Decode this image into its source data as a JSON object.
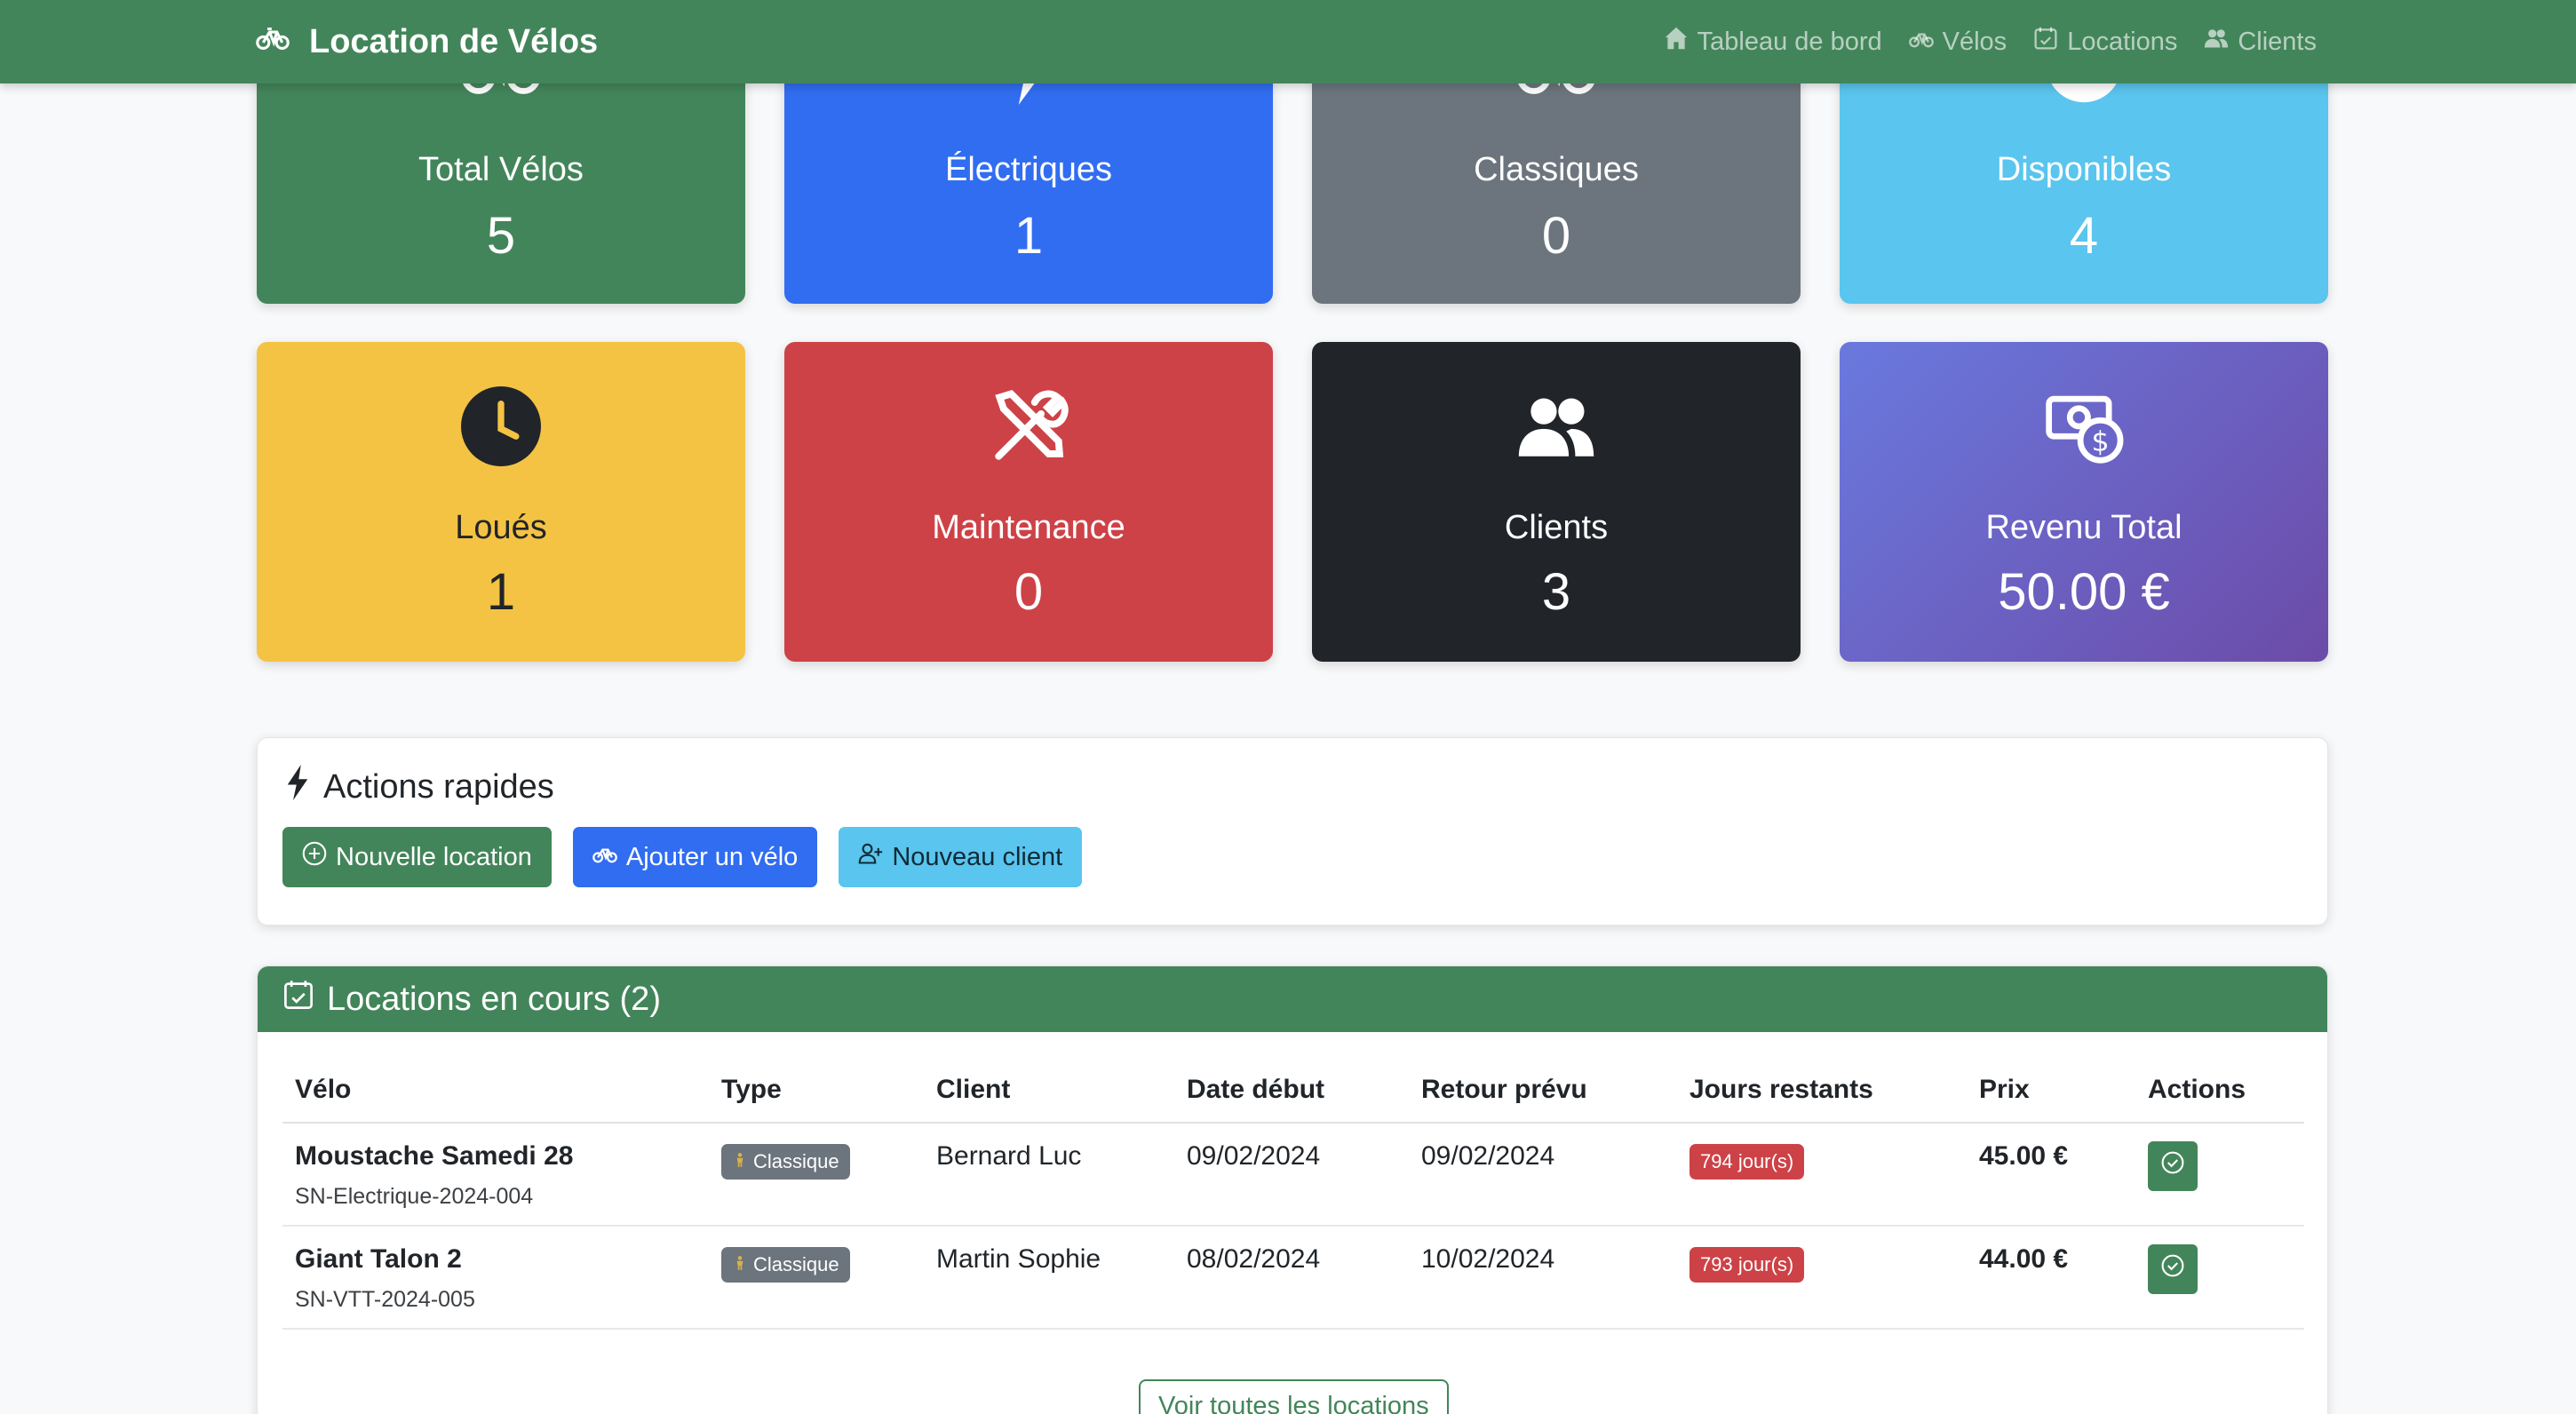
{
  "navbar": {
    "brand": "Location de Vélos",
    "links": [
      {
        "label": "Tableau de bord",
        "icon": "house-icon"
      },
      {
        "label": "Vélos",
        "icon": "bicycle-icon"
      },
      {
        "label": "Locations",
        "icon": "calendar-check-icon"
      },
      {
        "label": "Clients",
        "icon": "people-icon"
      }
    ]
  },
  "stats": [
    {
      "label": "Total Vélos",
      "value": "5",
      "icon": "bicycle-icon",
      "color": "#43855a"
    },
    {
      "label": "Électriques",
      "value": "1",
      "icon": "lightning-icon",
      "color": "#316df1"
    },
    {
      "label": "Classiques",
      "value": "0",
      "icon": "bicycle-icon",
      "color": "#6c757d"
    },
    {
      "label": "Disponibles",
      "value": "4",
      "icon": "check-circle-icon",
      "color": "#5ac5ee"
    },
    {
      "label": "Loués",
      "value": "1",
      "icon": "clock-icon",
      "color": "#f4c343"
    },
    {
      "label": "Maintenance",
      "value": "0",
      "icon": "tools-icon",
      "color": "#cd4247"
    },
    {
      "label": "Clients",
      "value": "3",
      "icon": "people-icon",
      "color": "#212429"
    },
    {
      "label": "Revenu Total",
      "value": "50.00 €",
      "icon": "cash-coin-icon",
      "color": "#6a5fc6"
    }
  ],
  "quick_actions": {
    "title": "Actions rapides",
    "buttons": [
      {
        "label": "Nouvelle location",
        "icon": "plus-circle-icon"
      },
      {
        "label": "Ajouter un vélo",
        "icon": "bicycle-icon"
      },
      {
        "label": "Nouveau client",
        "icon": "person-plus-icon"
      }
    ]
  },
  "rentals": {
    "title": "Locations en cours (2)",
    "columns": [
      "Vélo",
      "Type",
      "Client",
      "Date début",
      "Retour prévu",
      "Jours restants",
      "Prix",
      "Actions"
    ],
    "rows": [
      {
        "bike": "Moustache Samedi 28",
        "serial": "SN-Electrique-2024-004",
        "type": "Classique",
        "client": "Bernard Luc",
        "start": "09/02/2024",
        "return": "09/02/2024",
        "days": "794 jour(s)",
        "price": "45.00 €"
      },
      {
        "bike": "Giant Talon 2",
        "serial": "SN-VTT-2024-005",
        "type": "Classique",
        "client": "Martin Sophie",
        "start": "08/02/2024",
        "return": "10/02/2024",
        "days": "793 jour(s)",
        "price": "44.00 €"
      }
    ],
    "view_all": "Voir toutes les locations"
  }
}
